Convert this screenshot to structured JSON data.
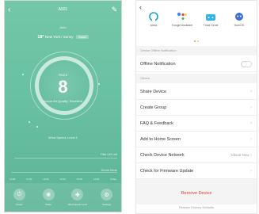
{
  "left_phone": {
    "title": "A501",
    "mode": "Auto",
    "weather": {
      "temp": "18°",
      "text": "New York / Sunny",
      "badge": "Good"
    },
    "pm": {
      "label": "PM2.5",
      "value": "8",
      "quality": "Indoor Air Quality: Excellent"
    },
    "wind_speed": "Wind Speed: Level 1",
    "filter_right_1": "Filter Life Left",
    "filter_right_2": "Device Mode",
    "timeline": [
      "11:00",
      "11:30",
      "12:00",
      "12:30",
      "13:00",
      "13:30",
      "Today"
    ],
    "buttons": [
      {
        "icon": "power-icon",
        "glyph": "⏻",
        "label": "Power"
      },
      {
        "icon": "mode-icon",
        "glyph": "✺",
        "label": "Mode"
      },
      {
        "icon": "fan-icon",
        "glyph": "✤",
        "label": "Wind Speed Level"
      },
      {
        "icon": "settings-icon",
        "glyph": "⚙",
        "label": "Settings"
      }
    ]
  },
  "right_phone": {
    "apps": [
      {
        "icon": "alexa-icon",
        "label": "Alexa",
        "color": "#1aa0d8"
      },
      {
        "icon": "google-assistant-icon",
        "label": "Google Assistant",
        "color": "#4285f4"
      },
      {
        "icon": "tmall-genie-icon",
        "label": "Tmall Genie",
        "color": "#2fb4e9"
      },
      {
        "icon": "duer-os-icon",
        "label": "DuerOS",
        "color": "#3a6fd8"
      }
    ],
    "section_offline": "Device Offline Notification",
    "offline_notification": "Offline Notification",
    "section_others": "Others",
    "rows": [
      {
        "label": "Share Device",
        "right": ""
      },
      {
        "label": "Create Group",
        "right": ""
      },
      {
        "label": "FAQ & Feedback",
        "right": ""
      },
      {
        "label": "Add to Home Screen",
        "right": ""
      },
      {
        "label": "Check Device Network",
        "right": "Check Now"
      },
      {
        "label": "Check for Firmware Update",
        "right": ""
      }
    ],
    "remove_device": "Remove Device",
    "restore_defaults": "Restore Factory Defaults"
  }
}
